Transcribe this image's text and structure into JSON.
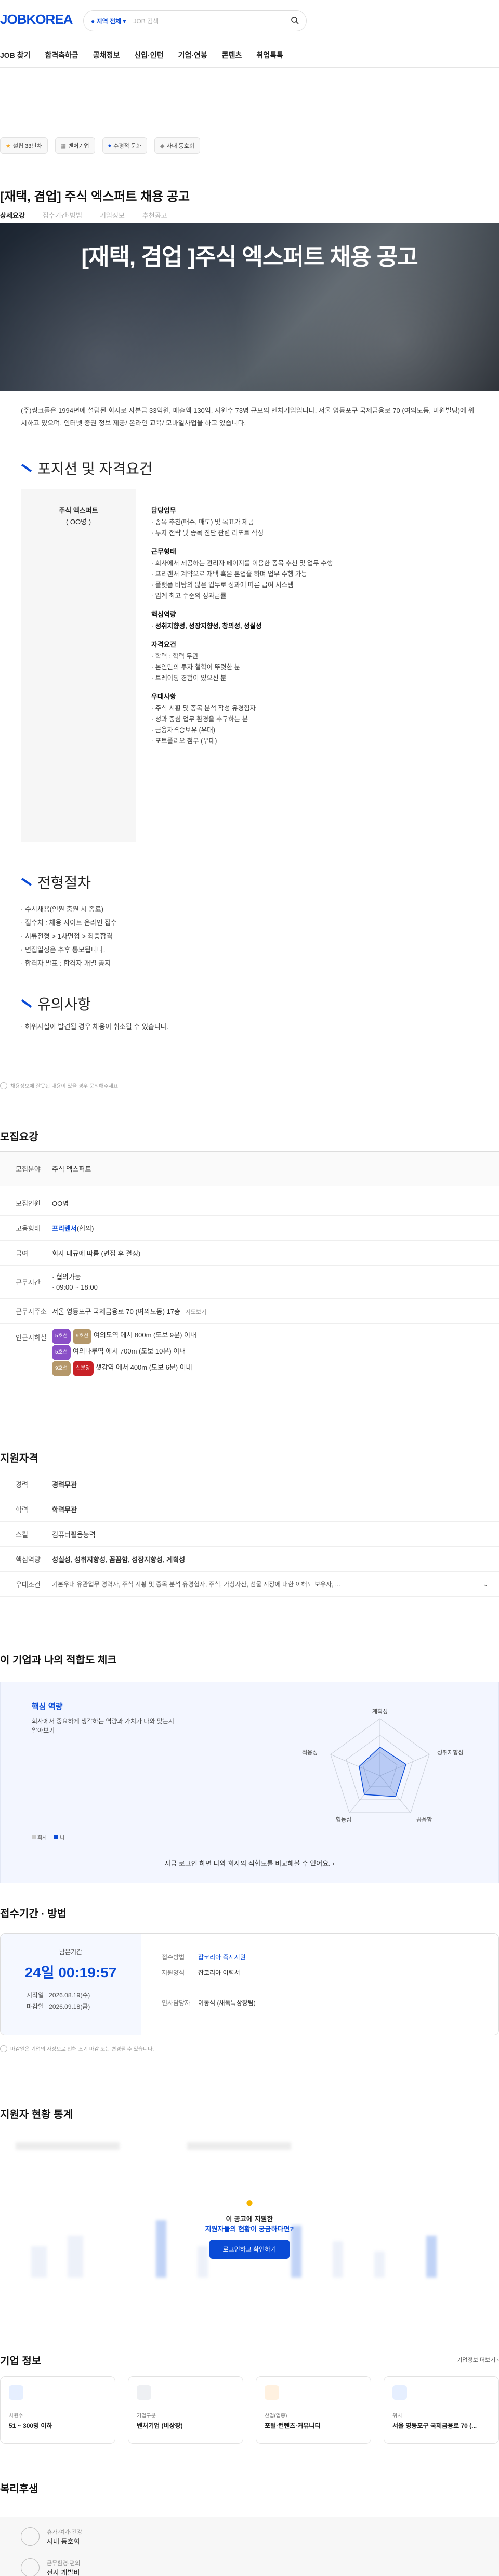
{
  "header": {
    "logo": "JOBKOREA",
    "location": "지역 전체",
    "search_placeholder": "JOB 검색",
    "nav": [
      "JOB 찾기",
      "합격축하금",
      "공채정보",
      "신입·인턴",
      "기업·연봉",
      "콘텐츠",
      "취업톡톡"
    ]
  },
  "chips": [
    "설립 33년차",
    "벤처기업",
    "수평적 문화",
    "사내 동호회"
  ],
  "job": {
    "title": "[재택, 겸업] 주식 엑스퍼트 채용 공고",
    "tabs": [
      "상세요강",
      "접수기간·방법",
      "기업정보",
      "추천공고"
    ],
    "hero_title": "[재택, 겸업 ]주식 엑스퍼트 채용 공고",
    "intro": "(주)씽크풀은 1994년에 설립된 회사로 자본금 33억원, 매출액 130억, 사원수 73명 규모의 벤처기업입니다. 서울 영등포구 국제금융로 70 (여의도동, 미원빌딩)에 위치하고 있으며, 인터넷 증권 정보 제공/ 온라인 교육/ 모바일사업을 하고 있습니다."
  },
  "position": {
    "heading": "포지션 및 자격요건",
    "role": "주식 엑스퍼트",
    "count": "( OO명 )",
    "groups": [
      {
        "title": "담당업무",
        "items": [
          "종목 추천(매수, 매도) 및 목표가 제공",
          "투자 전략 및 종목 진단 관련 리포트 작성"
        ]
      },
      {
        "title": "근무형태",
        "items": [
          "회사에서 제공하는 관리자 페이지를 이용한 종목 추천 및 업무 수행",
          "프리랜서 계약으로 재택 혹은 본업을 하며 업무 수행 가능",
          "플랫폼 바탕의 많은 업무로 성과에 따른 급여 시스템",
          "업계 최고 수준의 성과급률"
        ]
      },
      {
        "title": "핵심역량",
        "items": [
          "성취지향성, 성장지향성, 창의성, 성실성"
        ],
        "bold": true
      },
      {
        "title": "자격요건",
        "items": [
          "학력 : 학력 무관",
          "본인만의 투자 철학이 뚜렷한 분",
          "트레이딩 경험이 있으신 분"
        ]
      },
      {
        "title": "우대사항",
        "items": [
          "주식 시황 및 종목 분석 작성 유경험자",
          "성과 중심 업무 환경을 추구하는 분",
          "금융자격증보유 (우대)",
          "포트폴리오 첨부 (우대)"
        ]
      }
    ]
  },
  "process": {
    "heading": "전형절차",
    "steps": [
      "수시채용(인원 충원 시 종료)",
      "접수처 : 채용 사이트 온라인 접수",
      "서류전형 > 1차면접 > 최종합격",
      "면접일정은 추후 통보됩니다.",
      "합격자 발표 : 합격자 개별 공지"
    ]
  },
  "notice": {
    "heading": "유의사항",
    "items": [
      "허위사실이 발견될 경우 채용이 취소될 수 있습니다."
    ]
  },
  "disclaimer": "채용정보에 잘못된 내용이 있을 경우 문의해주세요.",
  "recruit": {
    "heading": "모집요강",
    "rows": [
      {
        "k": "모집분야",
        "v": "주식 엑스퍼트"
      },
      {
        "k": "모집인원",
        "v": "OO명"
      },
      {
        "k": "고용형태",
        "v": "프리랜서",
        "v2": "(협의)"
      },
      {
        "k": "급여",
        "v": "회사 내규에 따름 (면접 후 결정)"
      },
      {
        "k": "근무시간",
        "v": "· 협의가능",
        "v2": "· 09:00 ~ 18:00"
      },
      {
        "k": "근무지주소",
        "v": "서울 영등포구 국제금융로 70 (여의도동) 17층",
        "v2": "지도보기"
      }
    ],
    "transit_label": "인근지하철",
    "transit": [
      {
        "tags": [
          "5호선",
          "9호선"
        ],
        "text": "여의도역 에서 800m (도보 9분) 이내"
      },
      {
        "tags": [
          "5호선"
        ],
        "text": "여의나루역 에서 700m (도보 10분) 이내"
      },
      {
        "tags": [
          "9호선",
          "신분당"
        ],
        "text": "샛강역 에서 400m (도보 6분) 이내"
      }
    ]
  },
  "qual": {
    "heading": "지원자격",
    "rows": [
      {
        "k": "경력",
        "v": "경력무관"
      },
      {
        "k": "학력",
        "v": "학력무관"
      },
      {
        "k": "스킬",
        "v": "컴퓨터활용능력"
      },
      {
        "k": "핵심역량",
        "v": "성실성, 성취지향성, 꼼꼼함, 성장지향성, 계획성"
      },
      {
        "k": "우대조건",
        "v": "기본우대  유관업무 경력자, 주식 시황 및 종목 분석 유경험자, 주식, 가상자산, 선물 시장에 대한 이해도 보유자, ..."
      }
    ]
  },
  "fit": {
    "heading": "이 기업과 나의 적합도 체크",
    "title": "핵심 역량",
    "desc": "회사에서 중요하게 생각하는 역량과 가치가 나와 맞는지 알아보기",
    "legend": [
      "회사",
      "나"
    ],
    "axes": [
      "계획성",
      "성취지향성",
      "꼼꼼함",
      "협동심",
      "적응성"
    ],
    "login_msg": "지금 로그인 하면 나와 회사의 적합도를 비교해볼 수 있어요."
  },
  "apply": {
    "heading": "접수기간 · 방법",
    "remain_label": "남은기간",
    "remain": "24일 00:19:57",
    "start_label": "시작일",
    "start": "2026.08.19(수)",
    "end_label": "마감일",
    "end": "2026.09.18(금)",
    "method_label": "접수방법",
    "method": "잡코리아 즉시지원",
    "form_label": "지원양식",
    "form": "잡코리아 이력서",
    "manager_label": "인사담당자",
    "manager": "이동석 (새독특상장팀)",
    "note": "마감일은 기업의 사정으로 인해 조기 마감 또는 변경될 수 있습니다."
  },
  "stats": {
    "heading": "지원자 현황 통계",
    "question": "이 공고에 지원한",
    "question2": "지원자들의 현황이 궁금하다면?",
    "button": "로그인하고 확인하기"
  },
  "company": {
    "heading": "기업 정보",
    "more": "기업정보 더보기",
    "cards": [
      {
        "label": "사원수",
        "value": "51 ~ 300명 이하"
      },
      {
        "label": "기업구분",
        "value": "벤처기업 (비상장)"
      },
      {
        "label": "산업(업종)",
        "value": "포털·컨텐츠·커뮤니티"
      },
      {
        "label": "위치",
        "value": "서울 영등포구 국제금융로 70 (..."
      }
    ]
  },
  "welfare": {
    "heading": "복리후생",
    "items": [
      {
        "cat": "휴가·여가·건강",
        "val": "사내 동호회"
      },
      {
        "cat": "근무환경·편의",
        "val": "전사 개발비"
      }
    ]
  }
}
